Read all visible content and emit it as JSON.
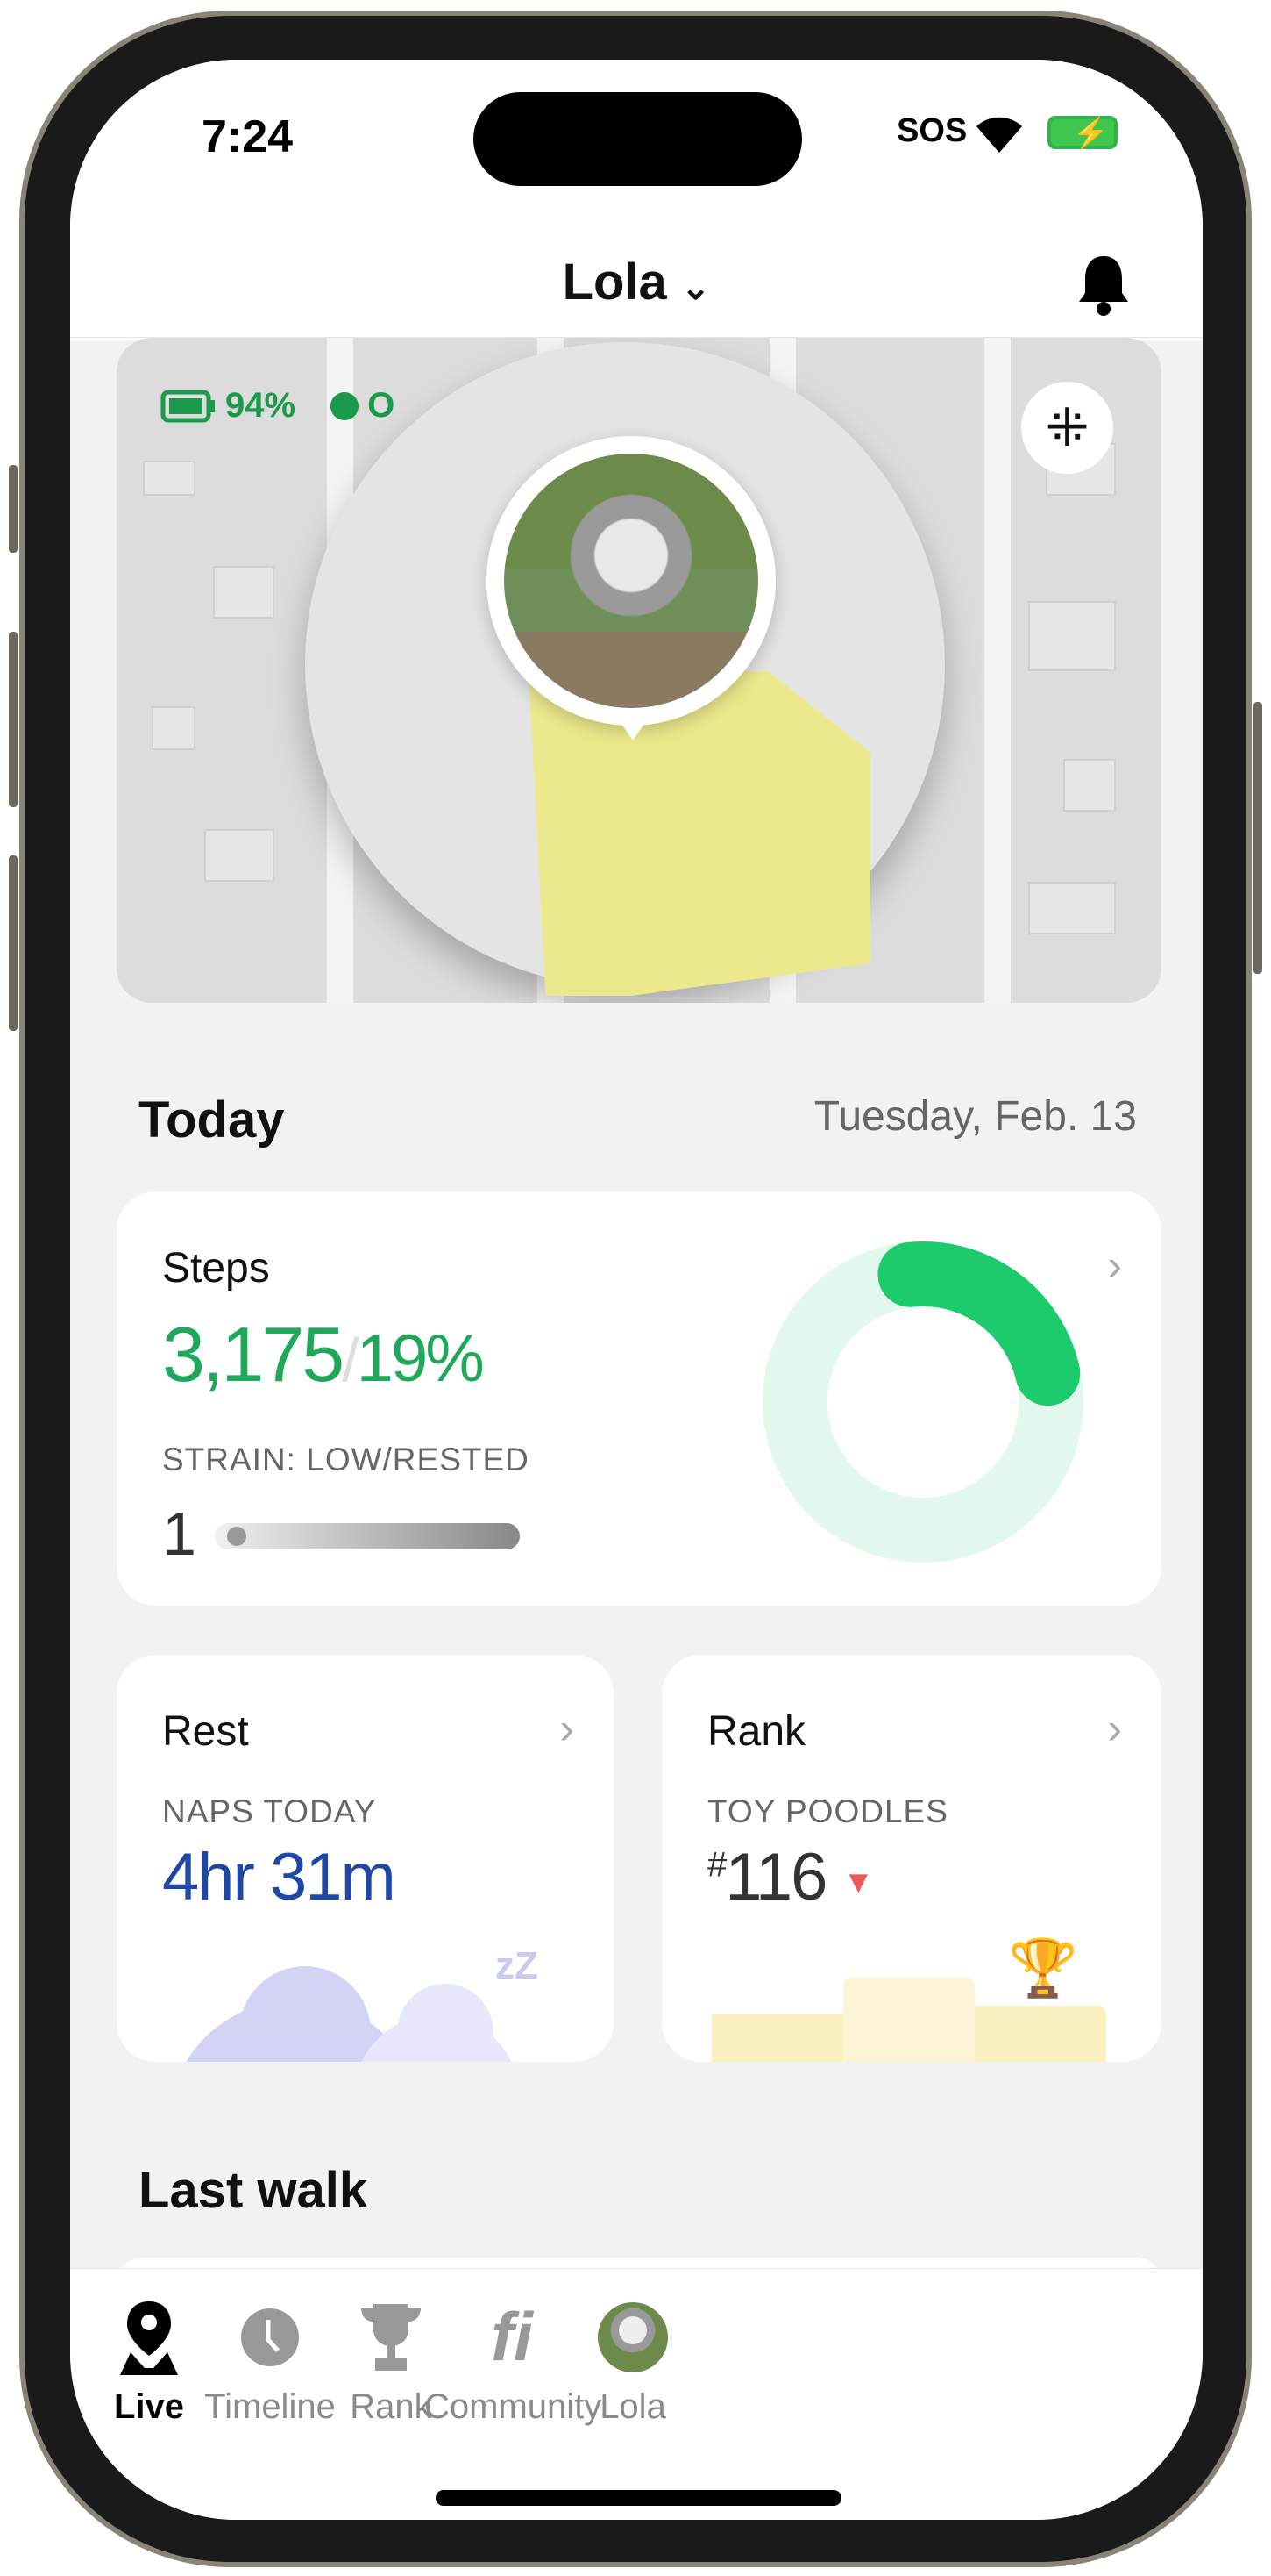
{
  "status_bar": {
    "time": "7:24",
    "sos": "SOS",
    "battery_charging": true
  },
  "header": {
    "pet_name": "Lola",
    "dropdown_icon": "chevron-down-icon",
    "notification_icon": "bell-icon"
  },
  "map": {
    "battery": "94%",
    "status_partial": "O",
    "lost_mode_icon": "sparkle-icon"
  },
  "today": {
    "title": "Today",
    "date": "Tuesday, Feb. 13"
  },
  "steps": {
    "title": "Steps",
    "count": "3,175",
    "separator": "/",
    "percent": "19%",
    "percent_value": 19,
    "strain_label": "STRAIN: LOW/RESTED",
    "strain_value": "1",
    "colors": {
      "accent": "#1fa85a",
      "ring": "#1ccb6c",
      "ring_bg": "#e3f8ec"
    }
  },
  "rest": {
    "title": "Rest",
    "label": "NAPS TODAY",
    "value": "4hr 31m",
    "zz": "zZ"
  },
  "rank": {
    "title": "Rank",
    "label": "TOY POODLES",
    "hash": "#",
    "value": "116",
    "trend": "down"
  },
  "last_walk": {
    "title": "Last walk"
  },
  "tabs": [
    {
      "label": "Live",
      "icon": "location-pin-icon",
      "active": true
    },
    {
      "label": "Timeline",
      "icon": "clock-icon"
    },
    {
      "label": "Rank",
      "icon": "trophy-icon"
    },
    {
      "label": "Community",
      "icon": "fi-logo-icon"
    },
    {
      "label": "Lola",
      "icon": "avatar"
    }
  ]
}
